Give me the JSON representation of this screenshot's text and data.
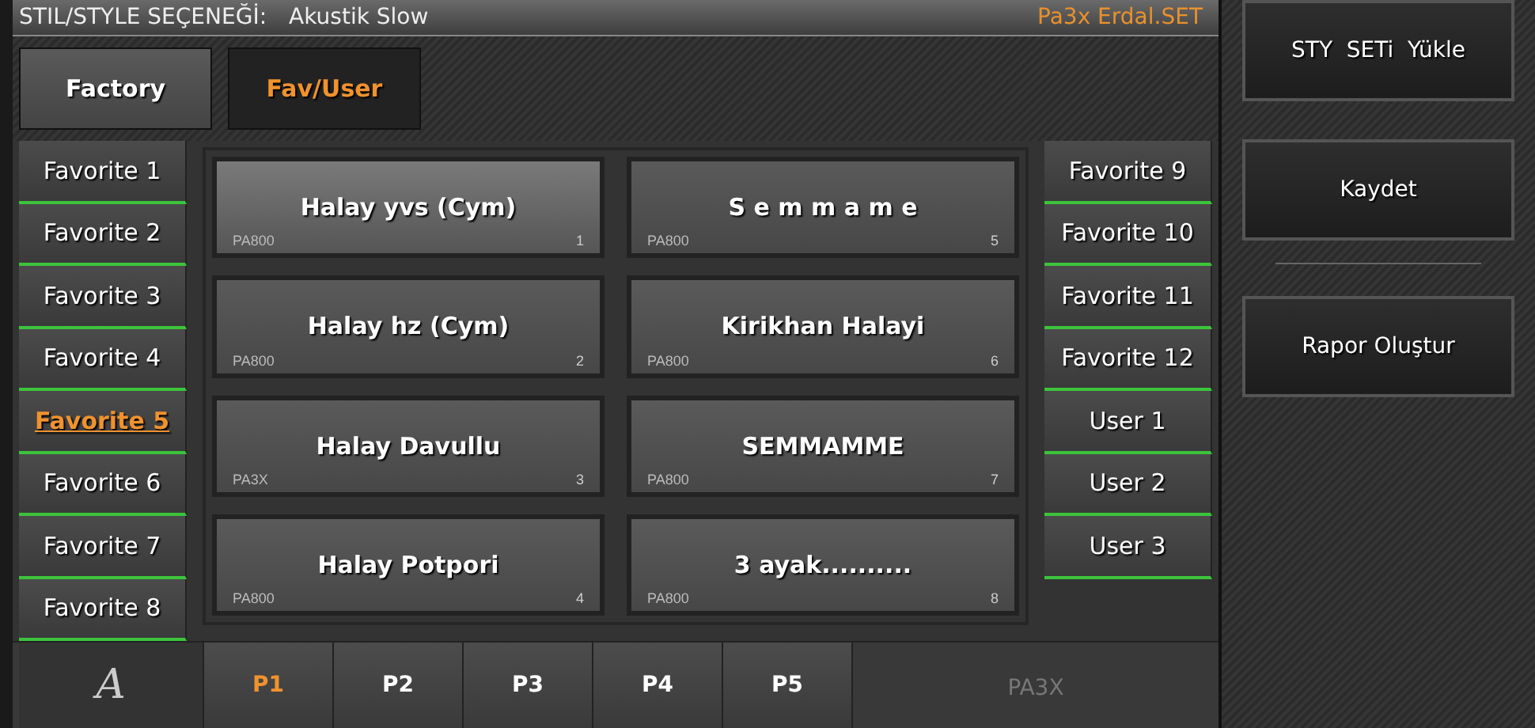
{
  "header": {
    "label": "STIL/STYLE SEÇENEĞİ:",
    "value": "Akustik Slow",
    "set_name": "Pa3x Erdal.SET"
  },
  "tabs": [
    {
      "label": "Factory",
      "selected": false
    },
    {
      "label": "Fav/User",
      "selected": true
    }
  ],
  "left_banks": [
    {
      "label": "Favorite 1",
      "selected": false
    },
    {
      "label": "Favorite 2",
      "selected": false
    },
    {
      "label": "Favorite 3",
      "selected": false
    },
    {
      "label": "Favorite 4",
      "selected": false
    },
    {
      "label": "Favorite 5",
      "selected": true
    },
    {
      "label": "Favorite 6",
      "selected": false
    },
    {
      "label": "Favorite 7",
      "selected": false
    },
    {
      "label": "Favorite 8",
      "selected": false
    }
  ],
  "styles": [
    {
      "name": "Halay yvs (Cym)",
      "source": "PA800",
      "number": "1",
      "selected": true
    },
    {
      "name": "Halay hz (Cym)",
      "source": "PA800",
      "number": "2",
      "selected": false
    },
    {
      "name": "Halay Davullu",
      "source": "PA3X",
      "number": "3",
      "selected": false
    },
    {
      "name": "Halay Potpori",
      "source": "PA800",
      "number": "4",
      "selected": false
    },
    {
      "name": "S e m m a m e",
      "source": "PA800",
      "number": "5",
      "selected": false
    },
    {
      "name": "Kirikhan Halayi",
      "source": "PA800",
      "number": "6",
      "selected": false
    },
    {
      "name": "SEMMAMME",
      "source": "PA800",
      "number": "7",
      "selected": false
    },
    {
      "name": "3 ayak..........",
      "source": "PA800",
      "number": "8",
      "selected": false
    }
  ],
  "right_banks": [
    {
      "label": "Favorite 9",
      "selected": false
    },
    {
      "label": "Favorite 10",
      "selected": false
    },
    {
      "label": "Favorite 11",
      "selected": false
    },
    {
      "label": "Favorite 12",
      "selected": false
    },
    {
      "label": "User 1",
      "selected": false
    },
    {
      "label": "User 2",
      "selected": false
    },
    {
      "label": "User 3",
      "selected": false
    }
  ],
  "footer": {
    "logo": "A",
    "pages": [
      {
        "label": "P1",
        "selected": true
      },
      {
        "label": "P2",
        "selected": false
      },
      {
        "label": "P3",
        "selected": false
      },
      {
        "label": "P4",
        "selected": false
      },
      {
        "label": "P5",
        "selected": false
      }
    ],
    "model": "PA3X"
  },
  "actions": [
    {
      "kind": "button",
      "label": "STY  SETi  Yükle"
    },
    {
      "kind": "button",
      "label": "Kaydet"
    },
    {
      "kind": "divider"
    },
    {
      "kind": "button",
      "label": "Rapor Oluştur"
    }
  ]
}
